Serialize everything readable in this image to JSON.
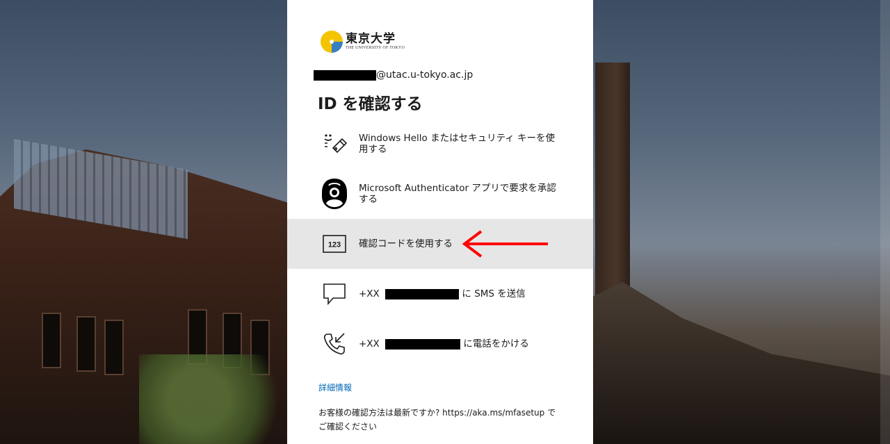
{
  "brand": {
    "name_jp": "東京大学",
    "name_en": "THE UNIVERSITY OF TOKYO",
    "logo_icon": "ginkgo-leaf-icon",
    "colors": {
      "yellow": "#f5c400",
      "blue": "#3a7fc1"
    }
  },
  "account": {
    "email_suffix": "@utac.u-tokyo.ac.jp"
  },
  "title": "ID を確認する",
  "options": [
    {
      "icon": "security-key-icon",
      "label": "Windows Hello またはセキュリティ キーを使用する"
    },
    {
      "icon": "authenticator-icon",
      "label": "Microsoft Authenticator アプリで要求を承認する"
    },
    {
      "icon": "code-123-icon",
      "label": "確認コードを使用する",
      "icon_text": "123",
      "selected": true
    },
    {
      "icon": "sms-chat-icon",
      "prefix": "+XX",
      "suffix": " に SMS を送信"
    },
    {
      "icon": "phone-call-icon",
      "prefix": "+XX",
      "suffix": " に電話をかける"
    }
  ],
  "more_info_link": "詳細情報",
  "footnote": "お客様の確認方法は最新ですか? https://aka.ms/mfasetup でご確認ください",
  "colors": {
    "accent_link": "#0067b8",
    "selected_bg": "#e6e6e6",
    "annotation_arrow": "#ff0000"
  }
}
